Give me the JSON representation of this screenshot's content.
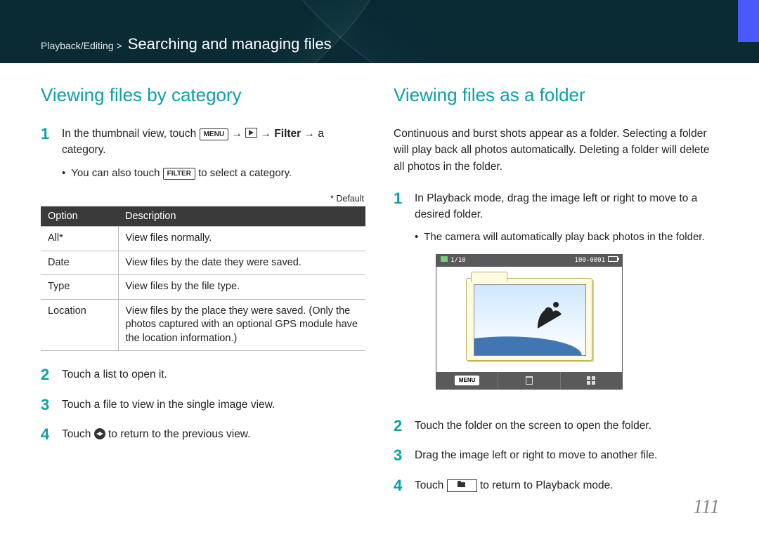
{
  "breadcrumb": "Playback/Editing >",
  "page_title": "Searching and managing files",
  "page_number": "111",
  "left": {
    "heading": "Viewing files by category",
    "step1_a": "In the thumbnail view, touch ",
    "step1_menu": "MENU",
    "step1_b": " → ",
    "step1_c": " → ",
    "step1_filter": "Filter",
    "step1_d": " → a category.",
    "bullet1_a": "You can also touch ",
    "bullet1_filter": "FILTER",
    "bullet1_b": " to select a category.",
    "default_note": "* Default",
    "table": {
      "head": {
        "option": "Option",
        "description": "Description"
      },
      "rows": [
        {
          "option": "All*",
          "description": "View files normally."
        },
        {
          "option": "Date",
          "description": "View files by the date they were saved."
        },
        {
          "option": "Type",
          "description": "View files by the file type."
        },
        {
          "option": "Location",
          "description": "View files by the place they were saved. (Only the photos captured with an optional GPS module have the location information.)"
        }
      ]
    },
    "step2": "Touch a list to open it.",
    "step3": "Touch a file to view in the single image view.",
    "step4_a": "Touch ",
    "step4_b": " to return to the previous view."
  },
  "right": {
    "heading": "Viewing files as a folder",
    "intro": "Continuous and burst shots appear as a folder. Selecting a folder will play back all photos automatically. Deleting a folder will delete all photos in the folder.",
    "step1": "In Playback mode, drag the image left or right to move to a desired folder.",
    "bullet1": "The camera will automatically play back photos in the folder.",
    "cam": {
      "counter": "1/10",
      "fileno": "100-0001",
      "menu": "MENU"
    },
    "step2": "Touch the folder on the screen to open the folder.",
    "step3": "Drag the image left or right to move to another file.",
    "step4_a": "Touch ",
    "step4_b": " to return to Playback mode."
  }
}
